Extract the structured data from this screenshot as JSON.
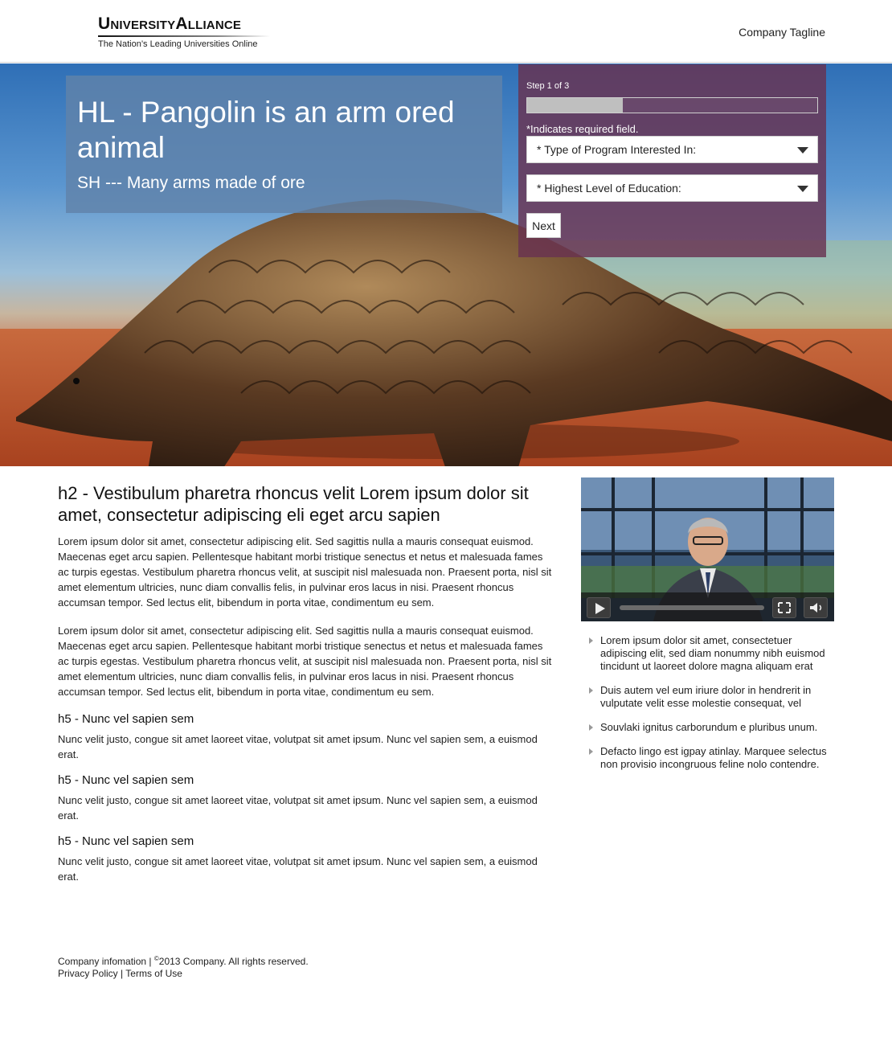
{
  "header": {
    "logo_name": "UniversityAlliance",
    "logo_tagline": "The Nation’s Leading Universities Online",
    "company_tagline": "Company Tagline"
  },
  "hero": {
    "title": "HL - Pangolin is an arm ored animal",
    "subtitle": "SH --- Many arms made of ore"
  },
  "form": {
    "step": "Step 1 of 3",
    "progress": 0.33,
    "required_note": "*Indicates required field.",
    "select_program": "* Type of Program Interested In:",
    "select_education": "* Highest Level of Education:",
    "next_label": "Next"
  },
  "main": {
    "h2": "h2 - Vestibulum pharetra rhoncus velit Lorem ipsum dolor sit amet, consectetur adipiscing eli eget arcu sapien",
    "paragraphs": [
      "Lorem ipsum dolor sit amet, consectetur adipiscing elit. Sed sagittis nulla a mauris consequat euismod. Maecenas eget arcu sapien. Pellentesque habitant morbi tristique senectus et netus et malesuada fames ac turpis egestas. Vestibulum pharetra rhoncus velit, at suscipit nisl malesuada non. Praesent porta, nisl sit amet elementum ultricies, nunc diam convallis felis, in pulvinar eros lacus in nisi. Praesent rhoncus accumsan tempor. Sed lectus elit, bibendum in porta vitae, condimentum eu sem.",
      "Lorem ipsum dolor sit amet, consectetur adipiscing elit. Sed sagittis nulla a mauris consequat euismod. Maecenas eget arcu sapien. Pellentesque habitant morbi tristique senectus et netus et malesuada fames ac turpis egestas. Vestibulum pharetra rhoncus velit, at suscipit nisl malesuada non. Praesent porta, nisl sit amet elementum ultricies, nunc diam convallis felis, in pulvinar eros lacus in nisi. Praesent rhoncus accumsan tempor. Sed lectus elit, bibendum in porta vitae, condimentum eu sem."
    ],
    "sections": [
      {
        "heading": "h5 - Nunc vel sapien sem",
        "text": "Nunc velit justo, congue sit amet laoreet vitae, volutpat sit amet ipsum. Nunc vel sapien sem, a euismod erat."
      },
      {
        "heading": "h5 - Nunc vel sapien sem",
        "text": "Nunc velit justo, congue sit amet laoreet vitae, volutpat sit amet ipsum. Nunc vel sapien sem, a euismod erat."
      },
      {
        "heading": "h5 - Nunc vel sapien sem",
        "text": "Nunc velit justo, congue sit amet laoreet vitae, volutpat sit amet ipsum. Nunc vel sapien sem, a euismod erat."
      }
    ]
  },
  "video": {
    "controls": [
      "play-icon",
      "fullscreen-icon",
      "volume-icon"
    ]
  },
  "sidebar": {
    "bullets": [
      "Lorem ipsum dolor sit amet, consectetuer adipiscing elit, sed diam nonummy nibh euismod tincidunt ut laoreet dolore magna aliquam erat",
      "Duis autem vel eum iriure dolor in hendrerit in vulputate velit esse molestie consequat, vel",
      "Souvlaki ignitus carborundum e pluribus unum.",
      "Defacto lingo est igpay atinlay. Marquee selectus non provisio incongruous feline nolo contendre."
    ]
  },
  "footer": {
    "company_info": "Company infomation",
    "separator": "|",
    "copyright_symbol": "©",
    "copyright_text": "2013 Company. All rights reserved.",
    "privacy": "Privacy Policy",
    "terms": "Terms of Use"
  },
  "colors": {
    "hero_box": "#6082aa",
    "form_panel": "#693250",
    "progress_fill": "#bfbfbf"
  }
}
